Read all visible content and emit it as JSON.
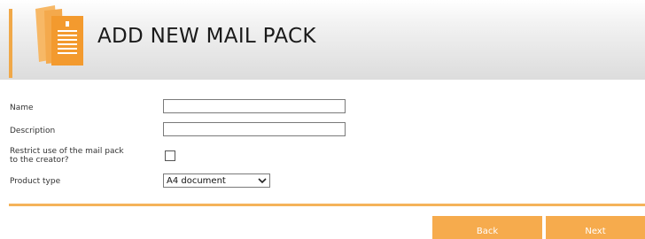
{
  "header": {
    "title": "ADD NEW MAIL PACK",
    "icon": "mail-pack-icon",
    "accent_color": "#f0a848"
  },
  "form": {
    "name_label": "Name",
    "name_value": "",
    "description_label": "Description",
    "description_value": "",
    "restrict_label_line1": "Restrict use of the mail pack",
    "restrict_label_line2": "to the creator?",
    "restrict_checked": false,
    "product_type_label": "Product type",
    "product_type_selected": "A4 document"
  },
  "footer": {
    "back_label": "Back",
    "next_label": "Next",
    "button_color": "#f6ab4d"
  }
}
